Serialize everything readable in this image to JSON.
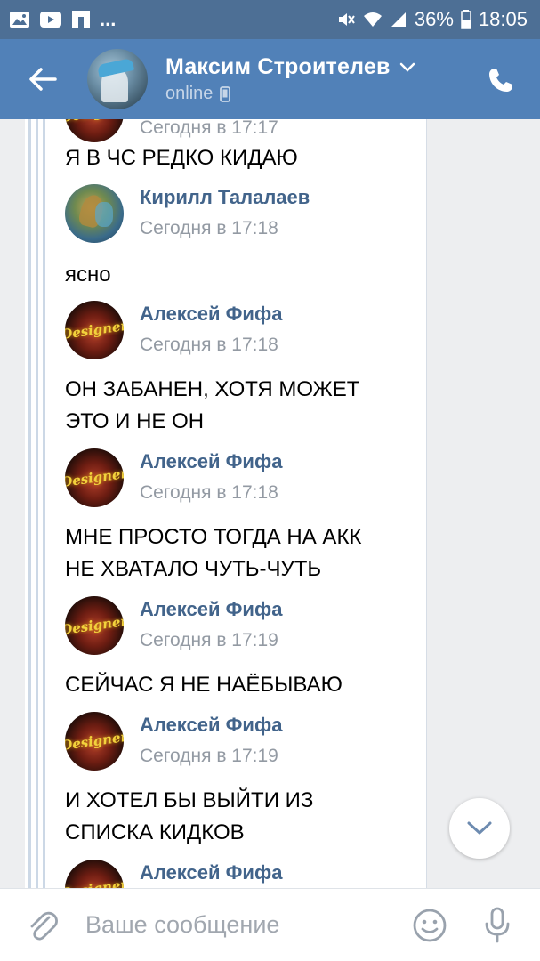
{
  "status_bar": {
    "battery": "36%",
    "time": "18:05",
    "dots": "...",
    "icons": [
      "gallery-icon",
      "youtube-icon",
      "flipboard-icon",
      "mute-icon",
      "wifi-icon",
      "signal-icon",
      "battery-icon"
    ]
  },
  "header": {
    "contact_name": "Максим Строителев",
    "status": "online",
    "icons": [
      "back-arrow-icon",
      "chevron-down-icon",
      "mobile-icon",
      "phone-icon"
    ]
  },
  "messages": [
    {
      "type": "text",
      "text": "Я В ЧС РЕДКО КИДАЮ"
    },
    {
      "type": "head",
      "sender": "Кирилл Талалаев",
      "time": "Сегодня в 17:18",
      "avatar": "kirill"
    },
    {
      "type": "text",
      "text": "ясно"
    },
    {
      "type": "head",
      "sender": "Алексей Фифа",
      "time": "Сегодня в 17:18",
      "avatar": "designer"
    },
    {
      "type": "text",
      "lines": [
        "ОН ЗАБАНЕН, ХОТЯ МОЖЕТ",
        "ЭТО И НЕ ОН"
      ]
    },
    {
      "type": "head",
      "sender": "Алексей Фифа",
      "time": "Сегодня в 17:18",
      "avatar": "designer"
    },
    {
      "type": "text",
      "lines": [
        "МНЕ ПРОСТО ТОГДА НА АКК",
        "НЕ ХВАТАЛО ЧУТЬ-ЧУТЬ"
      ]
    },
    {
      "type": "head",
      "sender": "Алексей Фифа",
      "time": "Сегодня в 17:19",
      "avatar": "designer"
    },
    {
      "type": "text",
      "text": "СЕЙЧАС Я НЕ НАЁБЫВАЮ"
    },
    {
      "type": "head",
      "sender": "Алексей Фифа",
      "time": "Сегодня в 17:19",
      "avatar": "designer"
    },
    {
      "type": "text",
      "lines": [
        "И ХОТЕЛ БЫ ВЫЙТИ ИЗ",
        "СПИСКА КИДКОВ"
      ]
    },
    {
      "type": "head",
      "sender": "Алексей Фифа",
      "avatar": "designer"
    }
  ],
  "top_partial_time": "Сегодня в 17:17",
  "avatar_logo_text": "Designer",
  "composer": {
    "placeholder": "Ваше сообщение",
    "icons": [
      "paperclip-icon",
      "emoji-icon",
      "microphone-icon"
    ]
  },
  "colors": {
    "status_bar": "#4d6f95",
    "header": "#5181b8",
    "sender_name": "#42648b",
    "timestamp": "#939aa3",
    "chat_bg": "#edeef0"
  }
}
